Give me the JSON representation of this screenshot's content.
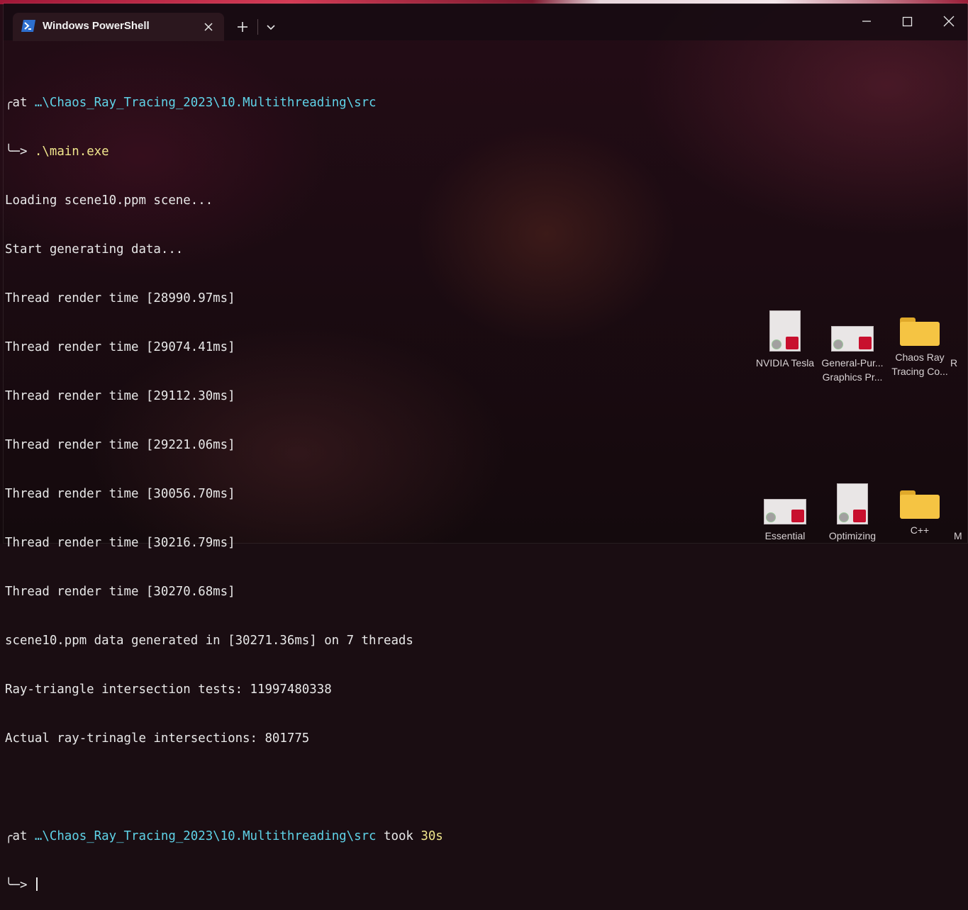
{
  "window": {
    "tab_title": "Windows PowerShell",
    "icons": {
      "tab": "powershell-icon",
      "close_tab": "close-icon",
      "new_tab": "plus-icon",
      "dropdown": "chevron-down-icon",
      "minimize": "minimize-icon",
      "maximize": "maximize-icon",
      "close_window": "close-icon"
    }
  },
  "terminal": {
    "prompt1": {
      "at": "at ",
      "path": "…\\Chaos_Ray_Tracing_2023\\10.Multithreading\\src",
      "command": ".\\main.exe"
    },
    "output": [
      "Loading scene10.ppm scene...",
      "Start generating data...",
      "Thread render time [28990.97ms]",
      "Thread render time [29074.41ms]",
      "Thread render time [29112.30ms]",
      "Thread render time [29221.06ms]",
      "Thread render time [30056.70ms]",
      "Thread render time [30216.79ms]",
      "Thread render time [30270.68ms]",
      "scene10.ppm data generated in [30271.36ms] on 7 threads",
      "Ray-triangle intersection tests: 11997480338",
      "Actual ray-trinagle intersections: 801775"
    ],
    "prompt2": {
      "at": "at ",
      "path": "…\\Chaos_Ray_Tracing_2023\\10.Multithreading\\src",
      "took_label": " took ",
      "took_value": "30s"
    },
    "prompt_top_glyph": "╭",
    "prompt_arrow_glyph": "╰─>"
  },
  "desktop": {
    "icons": [
      {
        "label": "NVIDIA Tesla",
        "type": "pdf"
      },
      {
        "label": "General-Pur... Graphics Pr...",
        "type": "pdf"
      },
      {
        "label": "Chaos Ray Tracing Co...",
        "type": "folder"
      },
      {
        "label": "Essential",
        "type": "pdf"
      },
      {
        "label": "Optimizing",
        "type": "pdf"
      },
      {
        "label": "C++",
        "type": "folder"
      },
      {
        "label": "R",
        "type": "partial"
      },
      {
        "label": "M",
        "type": "partial"
      }
    ]
  },
  "colors": {
    "path": "#5fd3e8",
    "command": "#f0e68c",
    "text": "#e8e8e8",
    "titlebar": "#180c12"
  }
}
